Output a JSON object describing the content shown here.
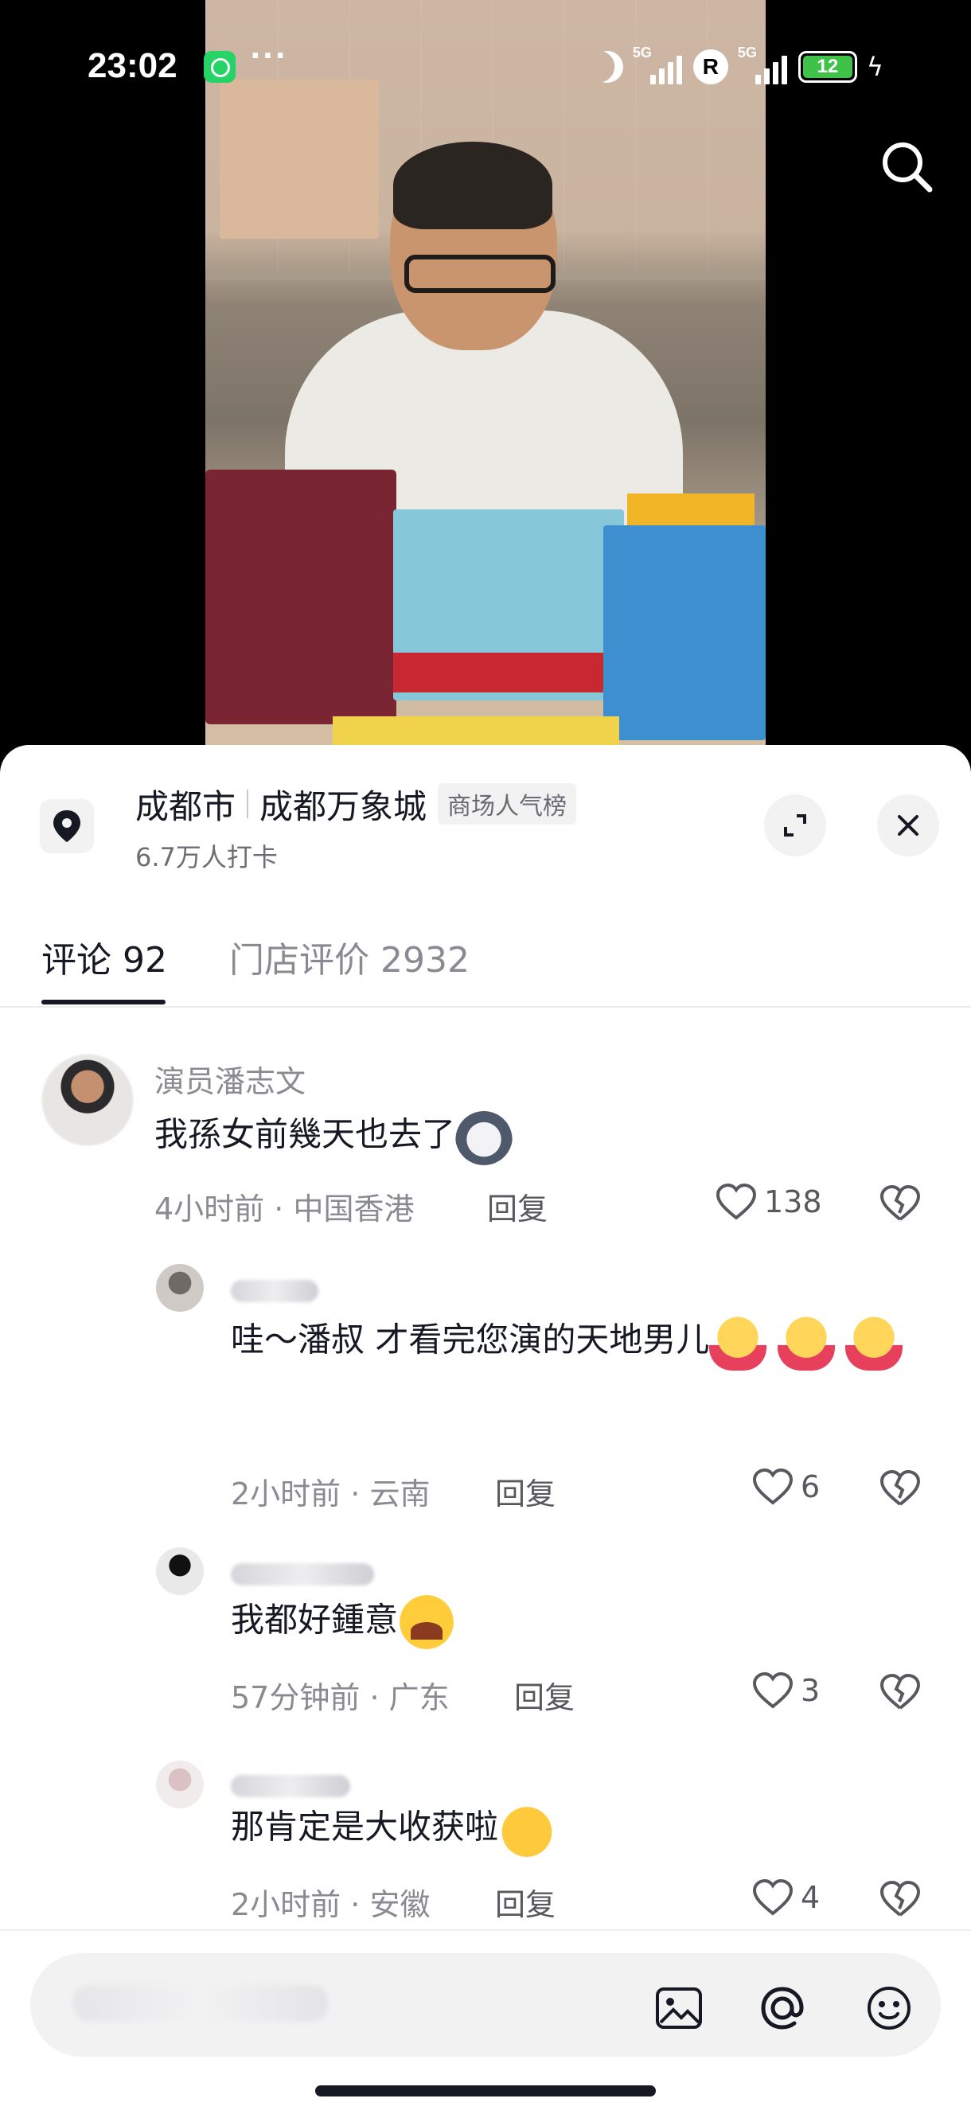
{
  "status_bar": {
    "time": "23:02",
    "network_1": "5G",
    "network_2": "5G",
    "roaming_badge": "R",
    "battery_level": "12"
  },
  "location": {
    "city": "成都市",
    "place": "成都万象城",
    "rank_tag": "商场人气榜",
    "checkins": "6.7万人打卡"
  },
  "tabs": [
    {
      "label": "评论 92",
      "active": true
    },
    {
      "label": "门店评价 2932",
      "active": false
    }
  ],
  "comments": [
    {
      "author": "演员潘志文",
      "text": "我孫女前幾天也去了",
      "time": "4小时前",
      "region": "中国香港",
      "reply": "回复",
      "likes": "138"
    },
    {
      "text": "哇～潘叔 才看完您演的天地男儿",
      "time": "2小时前",
      "region": "云南",
      "reply": "回复",
      "likes": "6"
    },
    {
      "text": "我都好鍾意",
      "time": "57分钟前",
      "region": "广东",
      "reply": "回复",
      "likes": "3"
    },
    {
      "text": "那肯定是大收获啦",
      "time": "2小时前",
      "region": "安徽",
      "reply": "回复",
      "likes": "4"
    }
  ],
  "colors": {
    "text_primary": "#161823",
    "text_secondary": "#8a8a92",
    "sheet_bg": "#ffffff"
  }
}
